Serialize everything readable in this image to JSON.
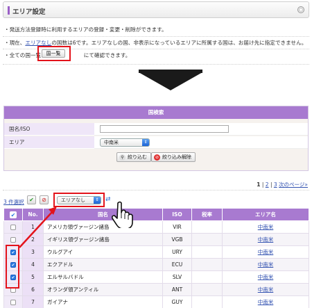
{
  "header": {
    "title": "エリア設定"
  },
  "info": {
    "line1": "・発送方法登録時に利用するエリアの登録・変更・削除ができます。",
    "line2_pre": "・現在、",
    "line2_link": "エリアなし",
    "line2_post": "の国数は6です。エリアなしの国、非表示になっているエリアに所属する国は、お届け先に指定できません。",
    "line3_pre": "・全ての国一覧は",
    "line3_button": "国一覧",
    "line3_post": "にて確認できます。"
  },
  "search": {
    "title": "国検索",
    "country_label": "国名/ISO",
    "country_value": "",
    "area_label": "エリア",
    "area_value": "中南米",
    "filter_button": "絞り込む",
    "clear_button": "絞り込み解除"
  },
  "pager": {
    "p1": "1",
    "sep1": " | ",
    "p2": "2",
    "sep2": " | ",
    "p3": "3",
    "sep3": " ",
    "next": "次のページ»"
  },
  "toolbar": {
    "selected_count": "3 件選択",
    "area_select": "エリアなし"
  },
  "table": {
    "headers": [
      "",
      "No.",
      "国名",
      "ISO",
      "税率",
      "エリア名"
    ],
    "rows": [
      {
        "checked": false,
        "no": "1",
        "name": "アメリカ領ヴァージン諸島",
        "iso": "VIR",
        "tax": "",
        "area": "中南米"
      },
      {
        "checked": false,
        "no": "2",
        "name": "イギリス領ヴァージン諸島",
        "iso": "VGB",
        "tax": "",
        "area": "中南米"
      },
      {
        "checked": true,
        "no": "3",
        "name": "ウルグアイ",
        "iso": "URY",
        "tax": "",
        "area": "中南米"
      },
      {
        "checked": true,
        "no": "4",
        "name": "エクアドル",
        "iso": "ECU",
        "tax": "",
        "area": "中南米"
      },
      {
        "checked": true,
        "no": "5",
        "name": "エルサルバドル",
        "iso": "SLV",
        "tax": "",
        "area": "中南米"
      },
      {
        "checked": false,
        "no": "6",
        "name": "オランダ領アンティル",
        "iso": "ANT",
        "tax": "",
        "area": "中南米"
      },
      {
        "checked": false,
        "no": "7",
        "name": "ガイアナ",
        "iso": "GUY",
        "tax": "",
        "area": "中南米"
      }
    ]
  },
  "colors": {
    "accent": "#a87ad0",
    "highlight": "#e3131b",
    "link": "#3050b0"
  },
  "icons": {
    "gear": "gear-icon",
    "search": "magnifier-icon",
    "clear": "no-entry-icon",
    "check": "checkmark-icon",
    "uncheck": "uncheck-icon",
    "apply": "arrows-icon",
    "cursor": "hand-cursor-icon"
  }
}
